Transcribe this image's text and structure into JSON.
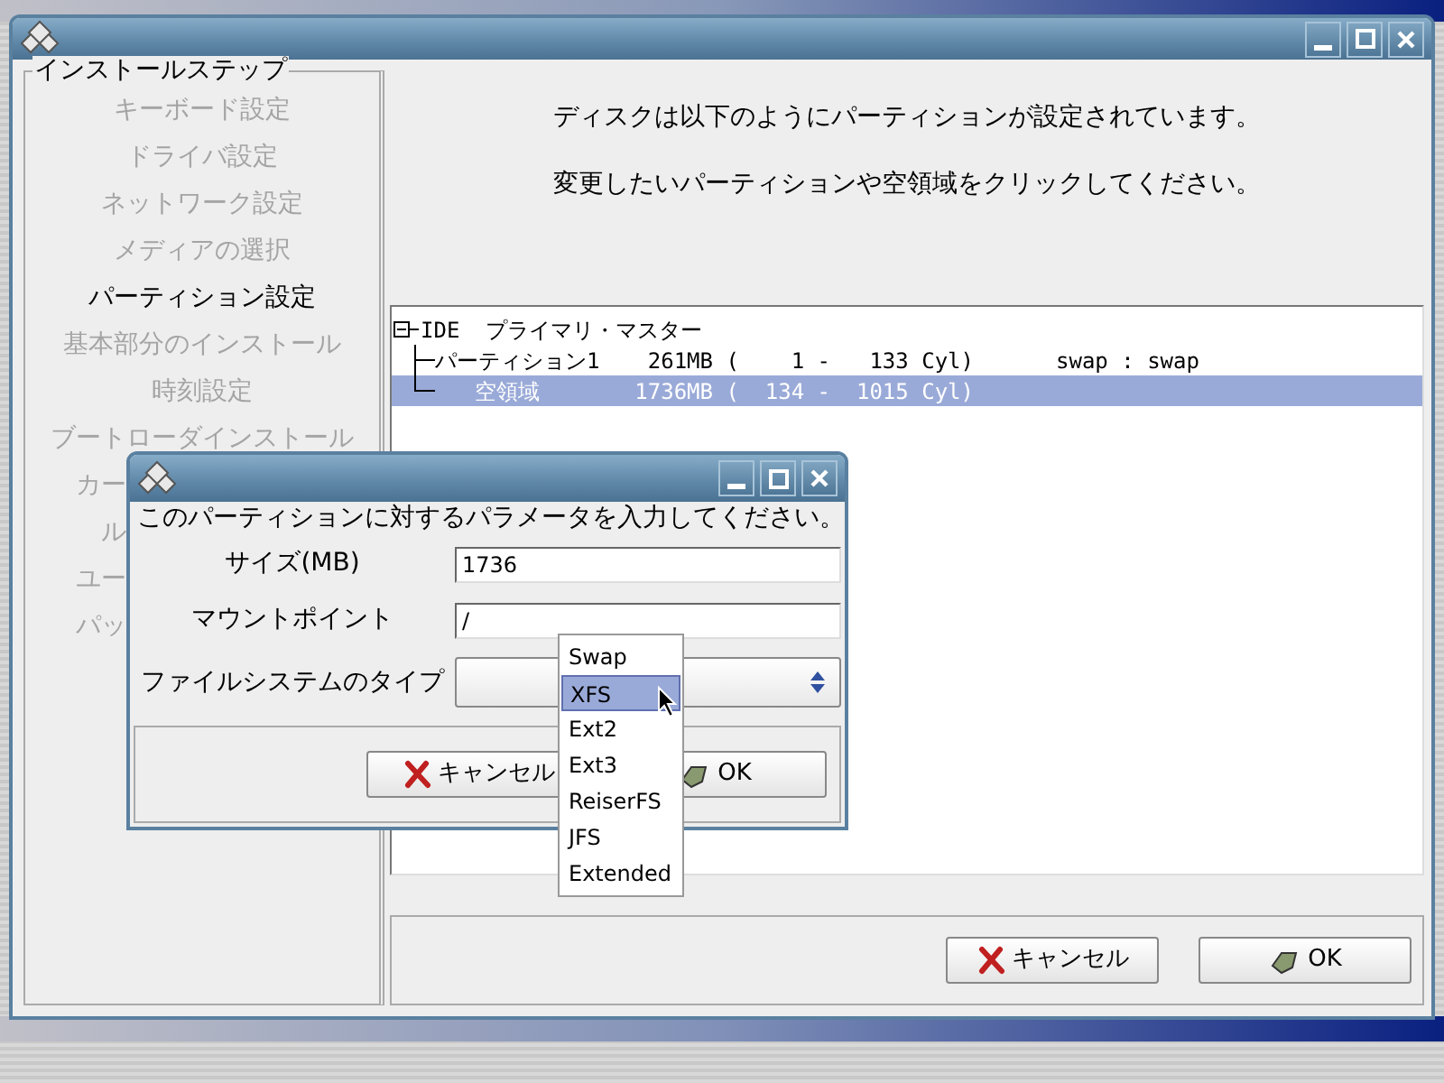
{
  "main_window": {
    "title_buttons": [
      {
        "kind": "minimize"
      },
      {
        "kind": "maximize"
      },
      {
        "kind": "close"
      }
    ]
  },
  "steps": {
    "title": "インストールステップ",
    "items": [
      {
        "label": "キーボード設定",
        "current": false,
        "clipped": false
      },
      {
        "label": "ドライバ設定",
        "current": false,
        "clipped": false
      },
      {
        "label": "ネットワーク設定",
        "current": false,
        "clipped": false
      },
      {
        "label": "メディアの選択",
        "current": false,
        "clipped": false
      },
      {
        "label": "パーティション設定",
        "current": true,
        "clipped": false
      },
      {
        "label": "基本部分のインストール",
        "current": false,
        "clipped": false
      },
      {
        "label": "時刻設定",
        "current": false,
        "clipped": false
      },
      {
        "label": "ブートローダインストール",
        "current": false,
        "clipped": false
      },
      {
        "label": "カー",
        "current": false,
        "clipped": true
      },
      {
        "label": "ル",
        "current": false,
        "clipped": true
      },
      {
        "label": "ユー",
        "current": false,
        "clipped": true
      },
      {
        "label": "パッ",
        "current": false,
        "clipped": true
      }
    ]
  },
  "messages": [
    "ディスクは以下のようにパーティションが設定されています。",
    "変更したいパーティションや空領域をクリックしてください。"
  ],
  "partition_tree": [
    {
      "name": "IDE  プライマリ・マスター",
      "expanded": true,
      "selected": false,
      "children": [
        {
          "name": "パーティション1",
          "size": "261MB",
          "range": "(    1 -   133 Cyl)",
          "fs": "swap : swap",
          "selected": false
        },
        {
          "name": "空領域",
          "size": "1736MB",
          "range": "(  134 -  1015 Cyl)",
          "selected": true
        }
      ]
    }
  ],
  "buttons": [
    {
      "kind": "cancel",
      "label": "キャンセル"
    },
    {
      "kind": "ok",
      "label": "OK"
    }
  ],
  "dialog": {
    "prompt": "このパーティションに対するパラメータを入力してください。",
    "fields": [
      {
        "kind": "text",
        "label": "サイズ(MB)",
        "value": "1736"
      },
      {
        "kind": "text",
        "label": "マウントポイント",
        "value": "/"
      },
      {
        "kind": "select",
        "label": "ファイルシステムのタイプ"
      }
    ],
    "buttons": [
      {
        "kind": "cancel",
        "label": "キャンセル"
      },
      {
        "kind": "ok",
        "label": "OK"
      }
    ],
    "dropdown": [
      {
        "label": "Swap",
        "selected": false
      },
      {
        "label": "XFS",
        "selected": true
      },
      {
        "label": "Ext2",
        "selected": false
      },
      {
        "label": "Ext3",
        "selected": false
      },
      {
        "label": "ReiserFS",
        "selected": false
      },
      {
        "label": "JFS",
        "selected": false
      },
      {
        "label": "Extended",
        "selected": false
      }
    ]
  }
}
